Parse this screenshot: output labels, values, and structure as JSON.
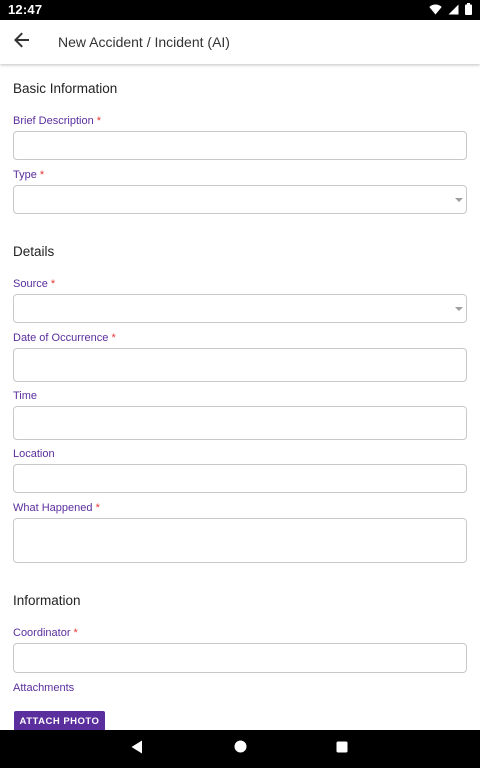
{
  "status_bar": {
    "time": "12:47"
  },
  "app_bar": {
    "title": "New Accident / Incident (AI)"
  },
  "sections": {
    "basic": "Basic Information",
    "details": "Details",
    "information": "Information"
  },
  "fields": {
    "brief_description": "Brief Description",
    "type": "Type",
    "source": "Source",
    "date_of_occurrence": "Date of Occurrence",
    "time": "Time",
    "location": "Location",
    "what_happened": "What Happened",
    "coordinator": "Coordinator",
    "attachments": "Attachments"
  },
  "required_marker": "*",
  "buttons": {
    "attach_photo": "ATTACH PHOTO"
  },
  "colors": {
    "accent": "#5b2e9e",
    "required": "#e53935"
  },
  "icons": [
    "wifi-icon",
    "signal-icon",
    "battery-icon",
    "back-arrow-icon",
    "nav-back-icon",
    "nav-home-icon",
    "nav-recents-icon"
  ]
}
